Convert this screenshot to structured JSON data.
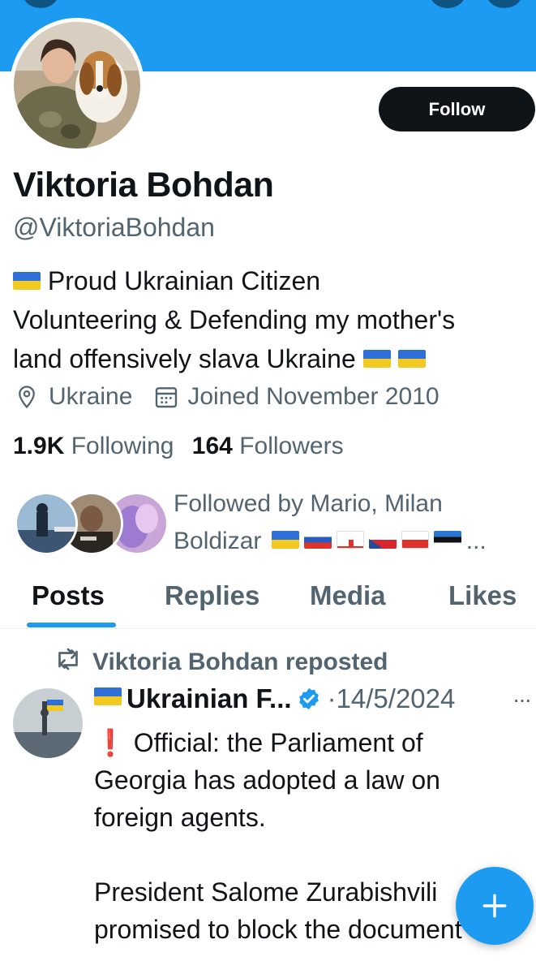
{
  "profile": {
    "name": "Viktoria Bohdan",
    "handle": "@ViktoriaBohdan",
    "follow_label": "Follow",
    "bio_lines": [
      "Proud Ukrainian Citizen",
      "Volunteering & Defending my mother's",
      "land offensively slava Ukraine"
    ],
    "location": "Ukraine",
    "joined": "Joined November 2010",
    "following_count": "1.9K",
    "following_label": "Following",
    "followers_count": "164",
    "followers_label": "Followers",
    "followed_by_line1": "Followed by Mario, Milan",
    "followed_by_line2": "Boldizar",
    "followed_by_ellipsis": "..."
  },
  "tabs": [
    {
      "label": "Posts",
      "active": true
    },
    {
      "label": "Replies",
      "active": false
    },
    {
      "label": "Media",
      "active": false
    },
    {
      "label": "Likes",
      "active": false
    }
  ],
  "post": {
    "repost_label": "Viktoria Bohdan reposted",
    "author": "Ukrainian F...",
    "date": "14/5/2024",
    "separator": "·",
    "text": "❗ Official: the Parliament of \nGeorgia has adopted a law on\nforeign agents.\n\nPresident Salome Zurabishvili\npromised to block the document",
    "more": "···"
  },
  "colors": {
    "accent": "#1d9bf0",
    "text": "#0f1419",
    "secondary": "#536471",
    "button": "#0f1419"
  },
  "icons": {
    "location": "location-pin-icon",
    "calendar": "calendar-icon",
    "repost": "repost-icon",
    "verified": "verified-badge-icon",
    "compose": "plus-icon"
  }
}
